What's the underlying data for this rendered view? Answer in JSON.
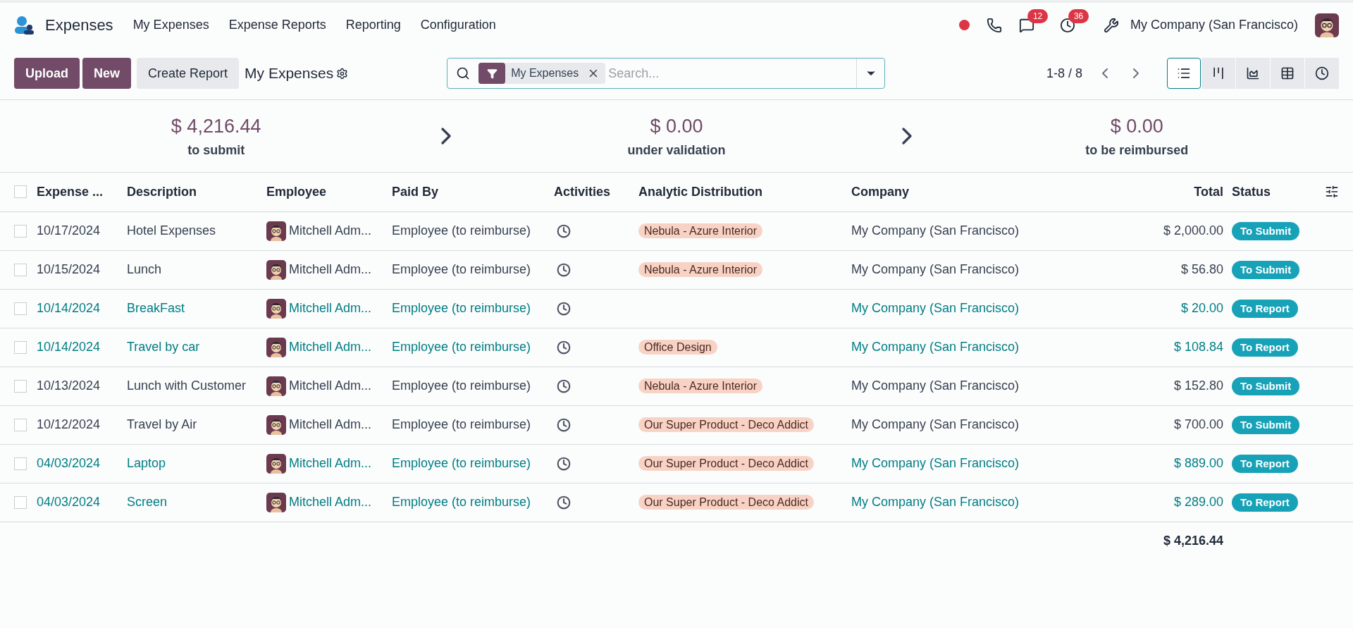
{
  "app": {
    "name": "Expenses",
    "menu": [
      "My Expenses",
      "Expense Reports",
      "Reporting",
      "Configuration"
    ]
  },
  "systray": {
    "messages_count": "12",
    "activities_count": "36",
    "company": "My Company (San Francisco)"
  },
  "control_panel": {
    "buttons": [
      "Upload",
      "New"
    ],
    "secondary_button": "Create Report",
    "breadcrumb": "My Expenses",
    "search": {
      "facet": "My Expenses",
      "placeholder": "Search..."
    },
    "pager": "1-8 / 8",
    "views": [
      {
        "kind": "list",
        "selected": true
      },
      {
        "kind": "kanban",
        "selected": false
      },
      {
        "kind": "graph",
        "selected": false
      },
      {
        "kind": "pivot",
        "selected": false
      },
      {
        "kind": "activity",
        "selected": false
      }
    ]
  },
  "summary": [
    {
      "amount": "$ 4,216.44",
      "label": "to submit"
    },
    {
      "amount": "$ 0.00",
      "label": "under validation"
    },
    {
      "amount": "$ 0.00",
      "label": "to be reimbursed"
    }
  ],
  "table": {
    "columns": [
      "Expense ...",
      "Description",
      "Employee",
      "Paid By",
      "Activities",
      "Analytic Distribution",
      "Company",
      "Total",
      "Status"
    ],
    "rows": [
      {
        "date": "10/17/2024",
        "description": "Hotel Expenses",
        "employee": "Mitchell Adm...",
        "paid_by": "Employee (to reimburse)",
        "analytic": "Nebula - Azure Interior",
        "company": "My Company (San Francisco)",
        "total": "$ 2,000.00",
        "status": "To Submit",
        "highlighted": false,
        "checked": false
      },
      {
        "date": "10/15/2024",
        "description": "Lunch",
        "employee": "Mitchell Adm...",
        "paid_by": "Employee (to reimburse)",
        "analytic": "Nebula - Azure Interior",
        "company": "My Company (San Francisco)",
        "total": "$ 56.80",
        "status": "To Submit",
        "highlighted": false,
        "checked": false
      },
      {
        "date": "10/14/2024",
        "description": "BreakFast",
        "employee": "Mitchell Adm...",
        "paid_by": "Employee (to reimburse)",
        "company": "My Company (San Francisco)",
        "total": "$ 20.00",
        "status": "To Report",
        "highlighted": true,
        "checked": false
      },
      {
        "date": "10/14/2024",
        "description": "Travel by car",
        "employee": "Mitchell Adm...",
        "paid_by": "Employee (to reimburse)",
        "analytic": "Office Design",
        "company": "My Company (San Francisco)",
        "total": "$ 108.84",
        "status": "To Report",
        "highlighted": true,
        "checked": false
      },
      {
        "date": "10/13/2024",
        "description": "Lunch with Customer",
        "employee": "Mitchell Adm...",
        "paid_by": "Employee (to reimburse)",
        "analytic": "Nebula - Azure Interior",
        "company": "My Company (San Francisco)",
        "total": "$ 152.80",
        "status": "To Submit",
        "highlighted": false,
        "checked": false
      },
      {
        "date": "10/12/2024",
        "description": "Travel by Air",
        "employee": "Mitchell Adm...",
        "paid_by": "Employee (to reimburse)",
        "analytic": "Our Super Product - Deco Addict",
        "company": "My Company (San Francisco)",
        "total": "$ 700.00",
        "status": "To Submit",
        "highlighted": false,
        "checked": false
      },
      {
        "date": "04/03/2024",
        "description": "Laptop",
        "employee": "Mitchell Adm...",
        "paid_by": "Employee (to reimburse)",
        "analytic": "Our Super Product - Deco Addict",
        "company": "My Company (San Francisco)",
        "total": "$ 889.00",
        "status": "To Report",
        "highlighted": true,
        "checked": false
      },
      {
        "date": "04/03/2024",
        "description": "Screen",
        "employee": "Mitchell Adm...",
        "paid_by": "Employee (to reimburse)",
        "analytic": "Our Super Product - Deco Addict",
        "company": "My Company (San Francisco)",
        "total": "$ 289.00",
        "status": "To Report",
        "highlighted": true,
        "checked": false
      }
    ],
    "grand_total": "$ 4,216.44",
    "all_checked": false
  }
}
